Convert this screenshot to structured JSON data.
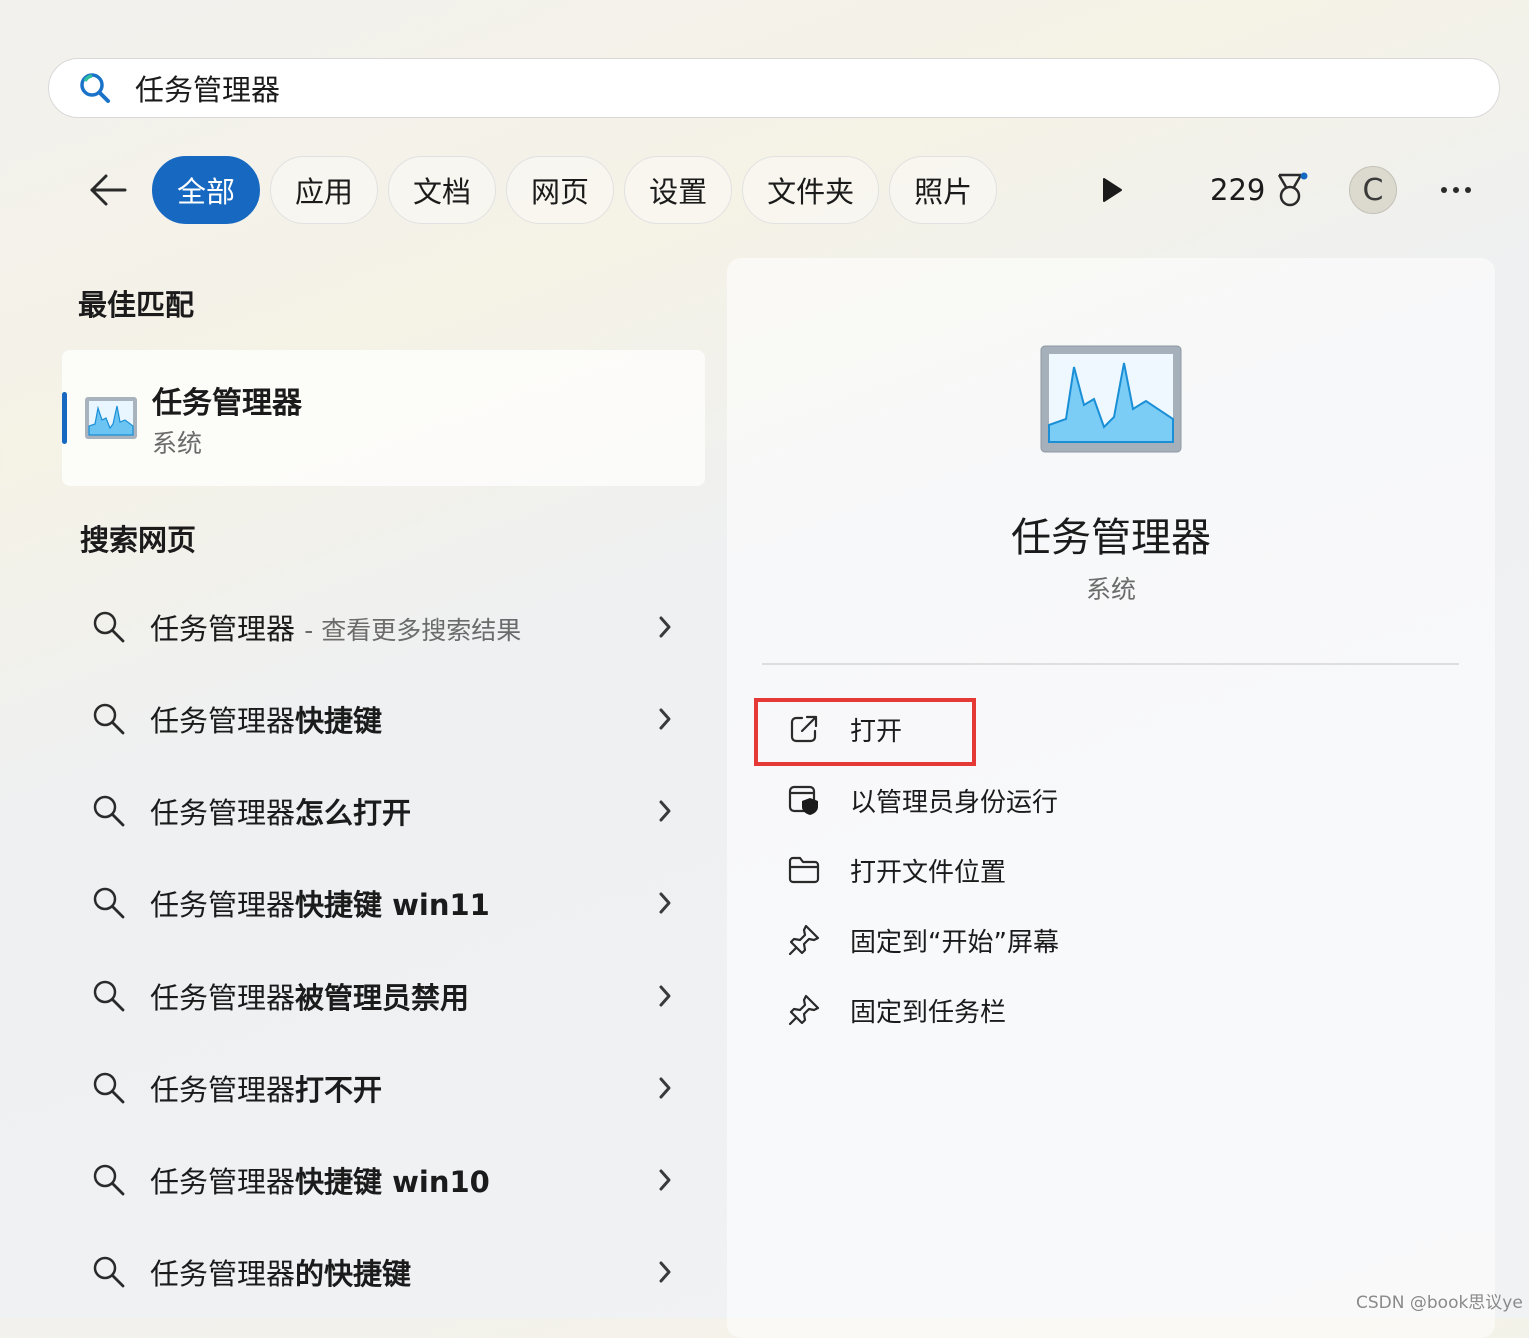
{
  "search": {
    "query": "任务管理器"
  },
  "filters": {
    "tabs": [
      {
        "label": "全部"
      },
      {
        "label": "应用"
      },
      {
        "label": "文档"
      },
      {
        "label": "网页"
      },
      {
        "label": "设置"
      },
      {
        "label": "文件夹"
      },
      {
        "label": "照片"
      }
    ],
    "active_tab": "全部",
    "points": "229",
    "avatar_initial": "C"
  },
  "best_match": {
    "title": "最佳匹配",
    "app_name": "任务管理器",
    "app_type": "系统"
  },
  "web_search": {
    "title": "搜索网页",
    "items": [
      {
        "prefix": "任务管理器",
        "suffix": "",
        "hint": "- 查看更多搜索结果"
      },
      {
        "prefix": "任务管理器",
        "suffix": "快捷键",
        "hint": ""
      },
      {
        "prefix": "任务管理器",
        "suffix": "怎么打开",
        "hint": ""
      },
      {
        "prefix": "任务管理器",
        "suffix": "快捷键 win11",
        "hint": ""
      },
      {
        "prefix": "任务管理器",
        "suffix": "被管理员禁用",
        "hint": ""
      },
      {
        "prefix": "任务管理器",
        "suffix": "打不开",
        "hint": ""
      },
      {
        "prefix": "任务管理器",
        "suffix": "快捷键 win10",
        "hint": ""
      },
      {
        "prefix": "任务管理器",
        "suffix": "的快捷键",
        "hint": ""
      }
    ]
  },
  "detail": {
    "app_name": "任务管理器",
    "app_type": "系统",
    "actions": [
      {
        "label": "打开",
        "icon": "open-external-icon"
      },
      {
        "label": "以管理员身份运行",
        "icon": "shield-admin-icon"
      },
      {
        "label": "打开文件位置",
        "icon": "folder-icon"
      },
      {
        "label": "固定到“开始”屏幕",
        "icon": "pin-icon"
      },
      {
        "label": "固定到任务栏",
        "icon": "pin-icon"
      }
    ]
  },
  "colors": {
    "accent": "#1668c1",
    "highlight": "#e53935"
  },
  "watermark": "CSDN @book思议ye"
}
